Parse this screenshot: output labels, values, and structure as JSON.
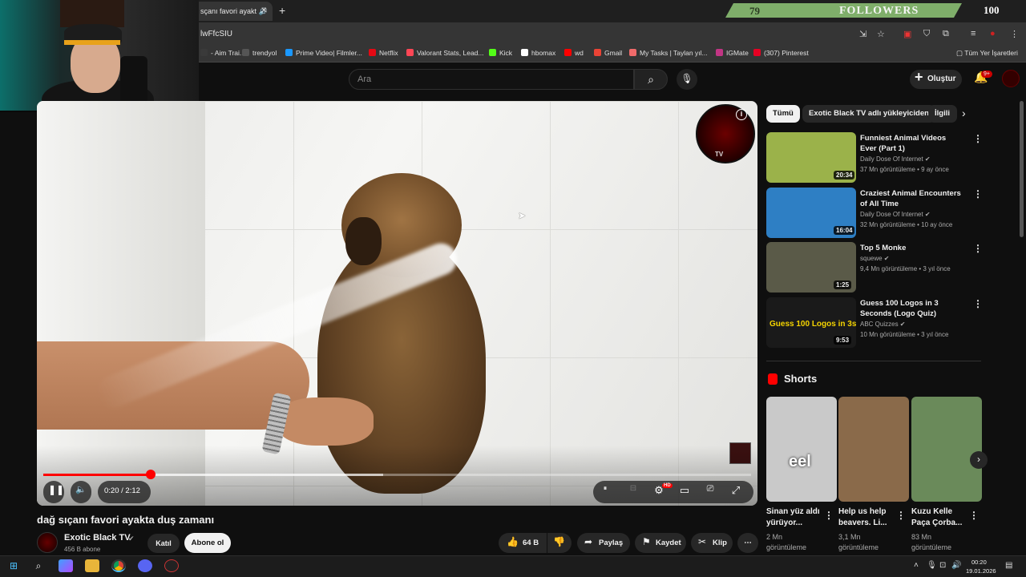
{
  "browser": {
    "tab_title": "sçanı favori ayakt",
    "url": "lwFfcSIU",
    "bookmarks": [
      {
        "label": "- Aim Trai...",
        "color": "#3a3a3a"
      },
      {
        "label": "trendyol",
        "color": "#555555"
      },
      {
        "label": "Prime Video| Filmler...",
        "color": "#1a98ff"
      },
      {
        "label": "Netflix",
        "color": "#e50914"
      },
      {
        "label": "Valorant Stats, Lead...",
        "color": "#ff4655"
      },
      {
        "label": "Kick",
        "color": "#53fc18"
      },
      {
        "label": "hbomax",
        "color": "#ffffff"
      },
      {
        "label": "wd",
        "color": "#ff0000"
      },
      {
        "label": "Gmail",
        "color": "#ea4335"
      },
      {
        "label": "My Tasks | Taylan yıl...",
        "color": "#f06a6a"
      },
      {
        "label": "IGMate",
        "color": "#c13584"
      },
      {
        "label": "(307) Pinterest",
        "color": "#e60023"
      }
    ],
    "all_bookmarks": "Tüm Yer İşaretleri"
  },
  "overlay": {
    "followers_count": "79",
    "followers_label": "FOLLOWERS",
    "followers_goal": "100",
    "followers_progress": 0.79
  },
  "header": {
    "search_placeholder": "Ara",
    "create_label": "Oluştur",
    "notifications_badge": "9+"
  },
  "video": {
    "logo_text": "TV",
    "time": "0:20 / 2:12",
    "progress": 0.152,
    "buffered": 0.48,
    "title": "dağ sıçanı favori ayakta duş zamanı",
    "channel": "Exotic Black TV",
    "subscribers": "456 B abone",
    "join_label": "Katıl",
    "subscribe_label": "Abone ol",
    "likes": "64 B",
    "share_label": "Paylaş",
    "save_label": "Kaydet",
    "clip_label": "Klip",
    "hd_badge": "HD"
  },
  "sidebar": {
    "chips": [
      "Tümü",
      "Exotic Black TV adlı yükleyiciden",
      "İlgili"
    ],
    "recommendations": [
      {
        "title": "Funniest Animal Videos Ever (Part 1)",
        "channel": "Daily Dose Of Internet",
        "meta": "37 Mn görüntüleme • 9 ay önce",
        "duration": "20:34",
        "thumb": "#9bb24a"
      },
      {
        "title": "Craziest Animal Encounters of All Time",
        "channel": "Daily Dose Of Internet",
        "meta": "32 Mn görüntüleme • 10 ay önce",
        "duration": "16:04",
        "thumb": "#2e7fc4"
      },
      {
        "title": "Top 5 Monke",
        "channel": "squewe",
        "meta": "9,4 Mn görüntüleme • 3 yıl önce",
        "duration": "1:25",
        "thumb": "#5a5a48"
      },
      {
        "title": "Guess 100 Logos in 3 Seconds (Logo Quiz)",
        "channel": "ABC Quizzes",
        "meta": "10 Mn görüntüleme • 3 yıl önce",
        "duration": "9:53",
        "thumb": "#1a1a1a",
        "thumb_text": "Guess 100 Logos in 3s"
      }
    ],
    "shorts_heading": "Shorts",
    "shorts": [
      {
        "title": "Sinan yüz aldı yürüyor...",
        "views": "2 Mn",
        "views2": "görüntüleme",
        "thumb": "#c9c9c9",
        "caption": "eel"
      },
      {
        "title": "Help us help beavers. Li...",
        "views": "3,1 Mn",
        "views2": "görüntüleme",
        "thumb": "#8a6a4a"
      },
      {
        "title": "Kuzu Kelle Paça Çorba...",
        "views": "83 Mn",
        "views2": "görüntüleme",
        "thumb": "#6a8a5a"
      }
    ]
  },
  "taskbar": {
    "time": "00:20",
    "date": "19.01.2026"
  }
}
